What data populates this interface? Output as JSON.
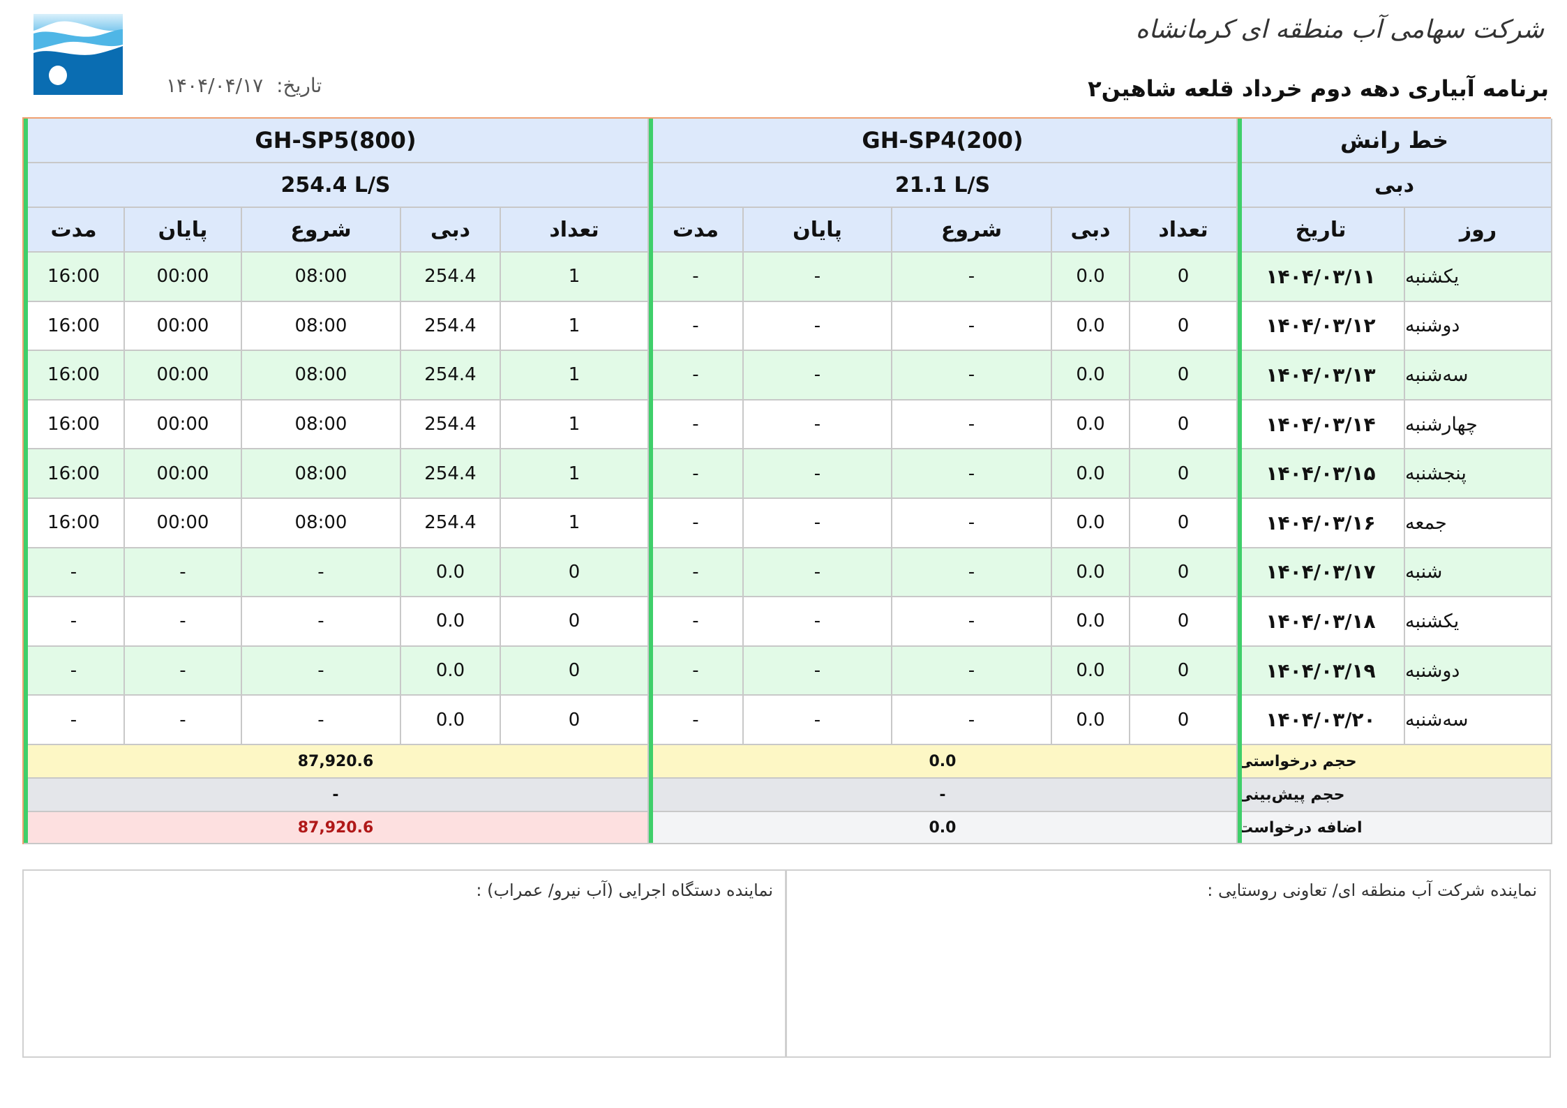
{
  "header": {
    "company": "شرکت سهامی آب منطقه ای کرمانشاه",
    "title": "برنامه آبیاری دهه دوم خرداد قلعه شاهین۲",
    "date_label": "تاریخ:",
    "date_value": "۱۴۰۴/۰۴/۱۷"
  },
  "colors": {
    "header_bg": "#dde9fb",
    "green_row": "#e2fae7",
    "accent_bar": "#3fcf6a",
    "border_orange": "#f0a070",
    "requested_bg": "#fdf7c5",
    "excess_bg": "#fde0e0"
  },
  "table": {
    "row_header_label": "خط رانش",
    "flow_header_label": "دبی",
    "day_col": "روز",
    "date_col": "تاریخ",
    "groups": [
      {
        "name": "GH-SP4(200)",
        "flow": "21.1 L/S"
      },
      {
        "name": "GH-SP5(800)",
        "flow": "254.4 L/S"
      }
    ],
    "sub_cols": {
      "count": "تعداد",
      "flow": "دبی",
      "start": "شروع",
      "end": "پایان",
      "duration": "مدت"
    },
    "rows": [
      {
        "day": "یکشنبه",
        "date": "۱۴۰۴/۰۳/۱۱",
        "sp4": [
          "0",
          "0.0",
          "-",
          "-",
          "-"
        ],
        "sp5": [
          "1",
          "254.4",
          "08:00",
          "00:00",
          "16:00"
        ]
      },
      {
        "day": "دوشنبه",
        "date": "۱۴۰۴/۰۳/۱۲",
        "sp4": [
          "0",
          "0.0",
          "-",
          "-",
          "-"
        ],
        "sp5": [
          "1",
          "254.4",
          "08:00",
          "00:00",
          "16:00"
        ]
      },
      {
        "day": "سه‌شنبه",
        "date": "۱۴۰۴/۰۳/۱۳",
        "sp4": [
          "0",
          "0.0",
          "-",
          "-",
          "-"
        ],
        "sp5": [
          "1",
          "254.4",
          "08:00",
          "00:00",
          "16:00"
        ]
      },
      {
        "day": "چهارشنبه",
        "date": "۱۴۰۴/۰۳/۱۴",
        "sp4": [
          "0",
          "0.0",
          "-",
          "-",
          "-"
        ],
        "sp5": [
          "1",
          "254.4",
          "08:00",
          "00:00",
          "16:00"
        ]
      },
      {
        "day": "پنجشنبه",
        "date": "۱۴۰۴/۰۳/۱۵",
        "sp4": [
          "0",
          "0.0",
          "-",
          "-",
          "-"
        ],
        "sp5": [
          "1",
          "254.4",
          "08:00",
          "00:00",
          "16:00"
        ]
      },
      {
        "day": "جمعه",
        "date": "۱۴۰۴/۰۳/۱۶",
        "sp4": [
          "0",
          "0.0",
          "-",
          "-",
          "-"
        ],
        "sp5": [
          "1",
          "254.4",
          "08:00",
          "00:00",
          "16:00"
        ]
      },
      {
        "day": "شنبه",
        "date": "۱۴۰۴/۰۳/۱۷",
        "sp4": [
          "0",
          "0.0",
          "-",
          "-",
          "-"
        ],
        "sp5": [
          "0",
          "0.0",
          "-",
          "-",
          "-"
        ]
      },
      {
        "day": "یکشنبه",
        "date": "۱۴۰۴/۰۳/۱۸",
        "sp4": [
          "0",
          "0.0",
          "-",
          "-",
          "-"
        ],
        "sp5": [
          "0",
          "0.0",
          "-",
          "-",
          "-"
        ]
      },
      {
        "day": "دوشنبه",
        "date": "۱۴۰۴/۰۳/۱۹",
        "sp4": [
          "0",
          "0.0",
          "-",
          "-",
          "-"
        ],
        "sp5": [
          "0",
          "0.0",
          "-",
          "-",
          "-"
        ]
      },
      {
        "day": "سه‌شنبه",
        "date": "۱۴۰۴/۰۳/۲۰",
        "sp4": [
          "0",
          "0.0",
          "-",
          "-",
          "-"
        ],
        "sp5": [
          "0",
          "0.0",
          "-",
          "-",
          "-"
        ]
      }
    ],
    "summary": [
      {
        "label": "حجم درخواستی",
        "sp4": "0.0",
        "sp5": "87,920.6"
      },
      {
        "label": "حجم پیش‌بینی",
        "sp4": "-",
        "sp5": "-"
      },
      {
        "label": "اضافه درخواست",
        "sp4": "0.0",
        "sp5": "87,920.6"
      }
    ]
  },
  "signatures": {
    "right": "نماینده شرکت آب منطقه ای/ تعاونی روستایی :",
    "left": "نماینده دستگاه اجرایی (آب نیرو/ عمراب) :"
  }
}
